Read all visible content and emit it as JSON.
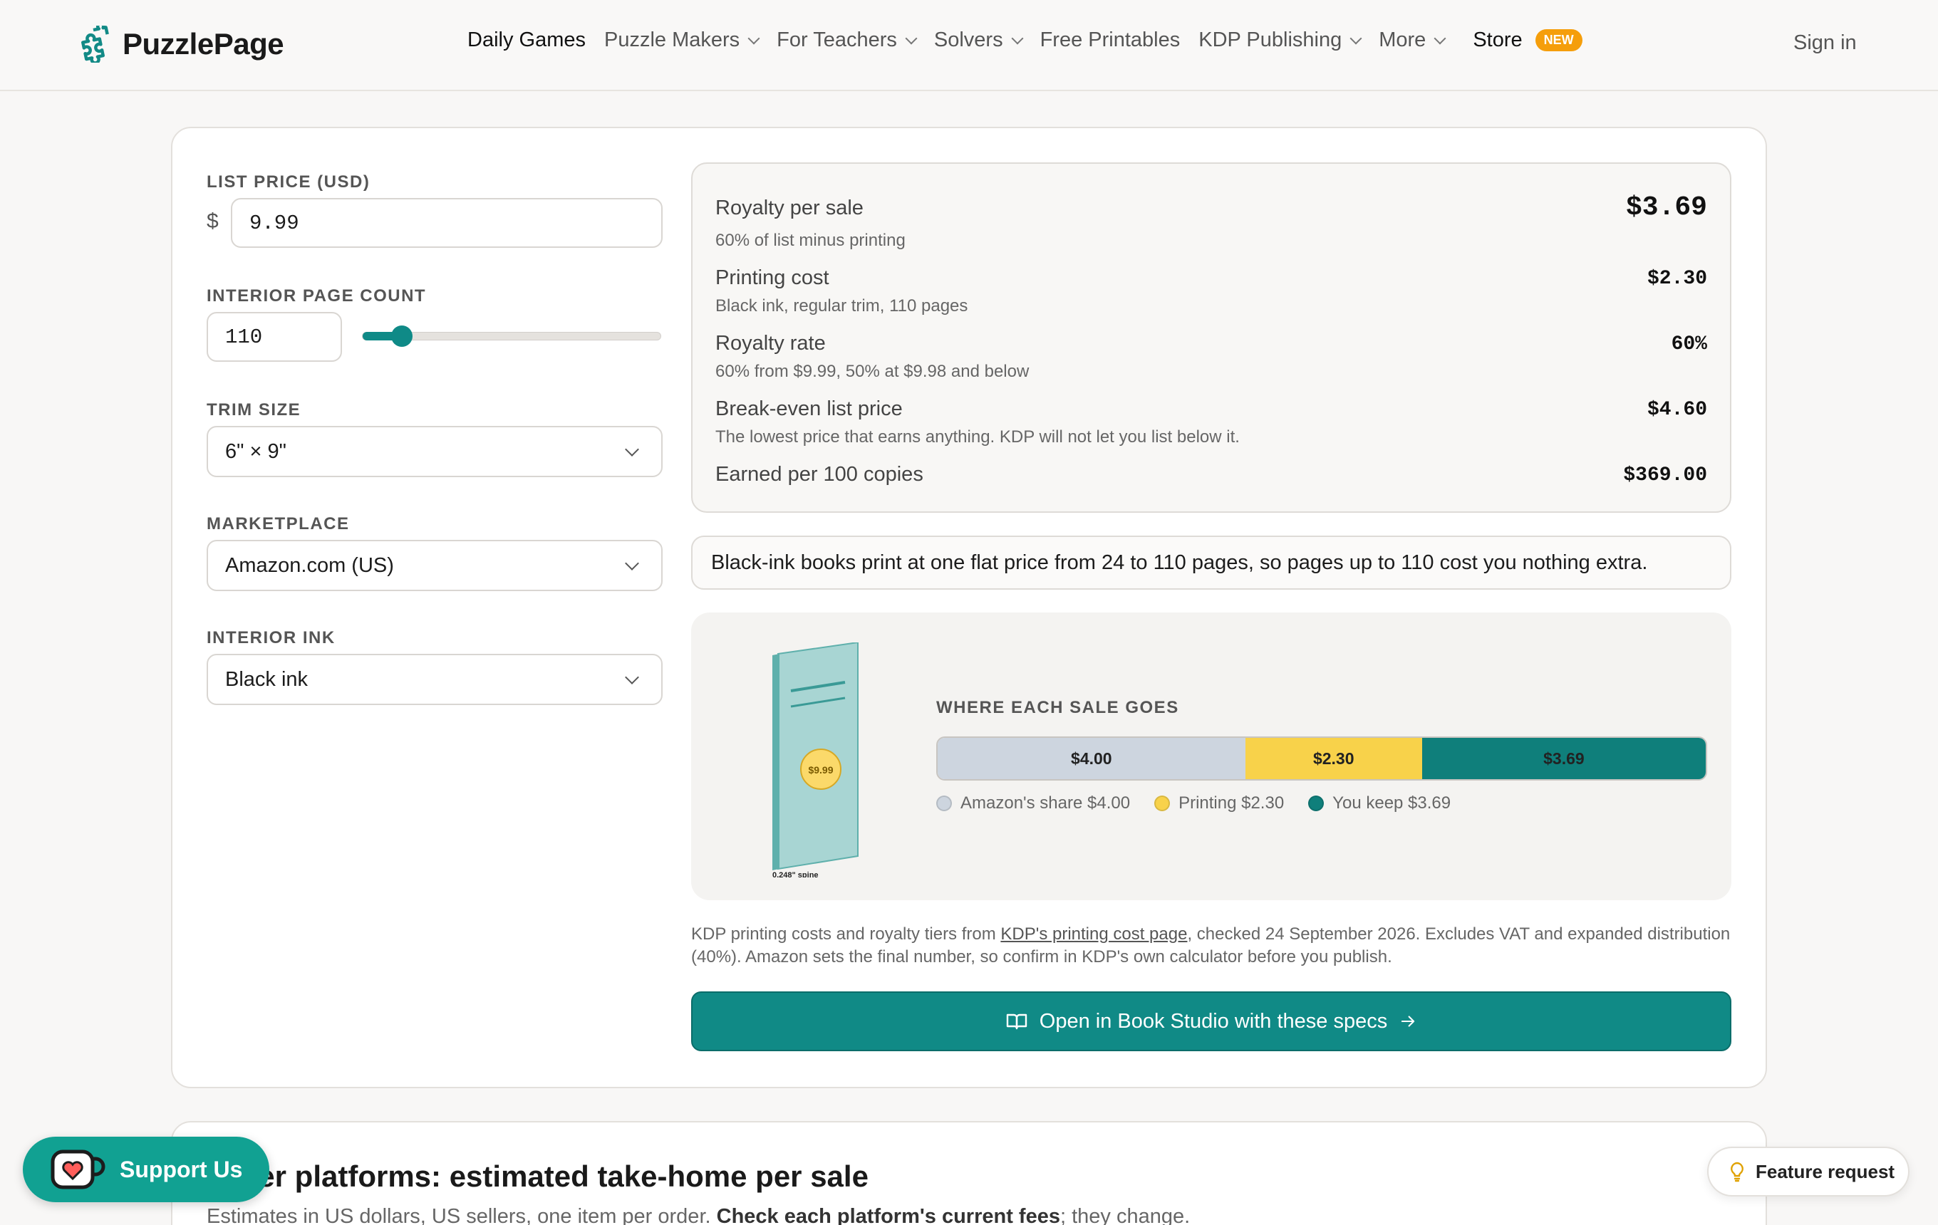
{
  "header": {
    "brand": "PuzzlePage",
    "nav": [
      {
        "label": "Daily Games",
        "dropdown": false,
        "strong": true
      },
      {
        "label": "Puzzle Makers",
        "dropdown": true
      },
      {
        "label": "For Teachers",
        "dropdown": true
      },
      {
        "label": "Solvers",
        "dropdown": true
      },
      {
        "label": "Free Printables",
        "dropdown": false
      },
      {
        "label": "KDP Publishing",
        "dropdown": true
      },
      {
        "label": "More",
        "dropdown": true
      }
    ],
    "store_label": "Store",
    "store_badge": "NEW",
    "signin": "Sign in"
  },
  "form": {
    "list_price_label": "LIST PRICE (USD)",
    "currency_symbol": "$",
    "list_price_value": "9.99",
    "page_count_label": "INTERIOR PAGE COUNT",
    "page_count_value": "110",
    "page_count_slider_fraction": 0.13,
    "trim_label": "TRIM SIZE",
    "trim_value": "6\" × 9\"",
    "marketplace_label": "MARKETPLACE",
    "marketplace_value": "Amazon.com (US)",
    "ink_label": "INTERIOR INK",
    "ink_value": "Black ink"
  },
  "results": {
    "royalty_title": "Royalty per sale",
    "royalty_sub": "60% of list minus printing",
    "royalty_value": "$3.69",
    "printing_title": "Printing cost",
    "printing_sub": "Black ink, regular trim, 110 pages",
    "printing_value": "$2.30",
    "rate_title": "Royalty rate",
    "rate_sub": "60% from $9.99, 50% at $9.98 and below",
    "rate_value": "60%",
    "breakeven_title": "Break-even list price",
    "breakeven_sub": "The lowest price that earns anything. KDP will not let you list below it.",
    "breakeven_value": "$4.60",
    "per100_title": "Earned per 100 copies",
    "per100_value": "$369.00"
  },
  "note": "Black-ink books print at one flat price from 24 to 110 pages, so pages up to 110 cost you nothing extra.",
  "visual": {
    "book_price": "$9.99",
    "spine_label": "0.248\" spine",
    "title": "WHERE EACH SALE GOES",
    "segments": [
      {
        "label": "$4.00",
        "value": 4.0,
        "color": "#cdd5df",
        "legend": "Amazon's share $4.00"
      },
      {
        "label": "$2.30",
        "value": 2.3,
        "color": "#f8d24a",
        "legend": "Printing $2.30"
      },
      {
        "label": "$3.69",
        "value": 3.69,
        "color": "#0f7f7b",
        "legend": "You keep $3.69"
      }
    ]
  },
  "footnote": {
    "before": "KDP printing costs and royalty tiers from ",
    "link": "KDP's printing cost page",
    "after": ", checked 24 September 2026. Excludes VAT and expanded distribution (40%). Amazon sets the final number, so confirm in KDP's own calculator before you publish."
  },
  "cta_label": "Open in Book Studio with these specs",
  "platforms": {
    "title": "Other platforms: estimated take-home per sale",
    "sub_before": "Estimates in US dollars, US sellers, one item per order. ",
    "sub_bold": "Check each platform's current fees",
    "sub_after": "; they change."
  },
  "support_label": "Support Us",
  "feature_label": "Feature request",
  "colors": {
    "accent": "#108a86",
    "badge": "#f59e0b"
  }
}
